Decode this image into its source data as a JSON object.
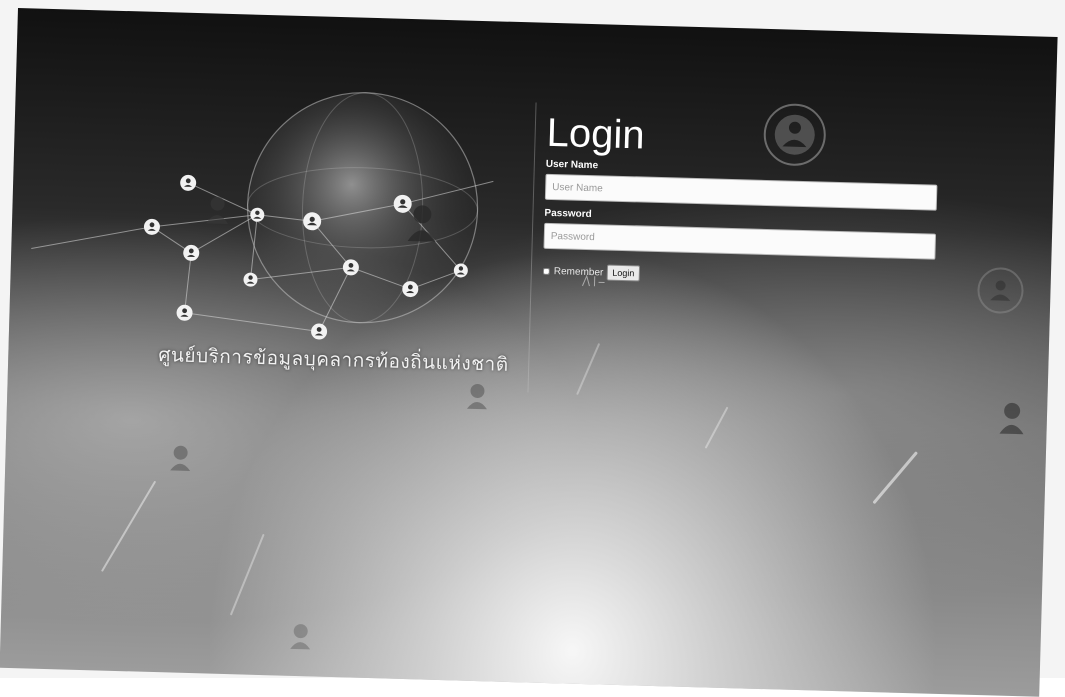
{
  "brand": {
    "tagline": "ศูนย์บริการข้อมูลบุคลากรท้องถิ่นแห่งชาติ"
  },
  "login": {
    "title": "Login",
    "username_label": "User Name",
    "username_placeholder": "User Name",
    "password_label": "Password",
    "password_placeholder": "Password",
    "remember_label": "Remember",
    "submit_label": "Login"
  },
  "colors": {
    "background_dark": "#1a1a1a",
    "text_light": "#ffffff",
    "input_bg": "#fbfbfb"
  }
}
